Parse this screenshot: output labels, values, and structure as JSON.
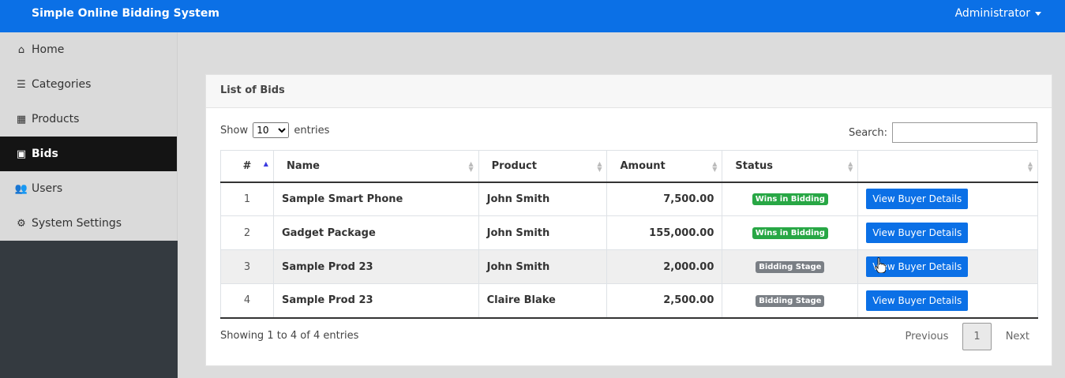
{
  "header": {
    "title": "Simple Online Bidding System",
    "user": "Administrator"
  },
  "sidebar": {
    "items": [
      {
        "label": "Home",
        "icon": "home-icon",
        "glyph": "⌂"
      },
      {
        "label": "Categories",
        "icon": "list-icon",
        "glyph": "☰"
      },
      {
        "label": "Products",
        "icon": "table-icon",
        "glyph": "▦"
      },
      {
        "label": "Bids",
        "icon": "money-icon",
        "glyph": "▣",
        "active": true
      },
      {
        "label": "Users",
        "icon": "users-icon",
        "glyph": "👥"
      },
      {
        "label": "System Settings",
        "icon": "cogs-icon",
        "glyph": "⚙"
      }
    ]
  },
  "card": {
    "title": "List of Bids",
    "show_label": "Show",
    "entries_label": "entries",
    "page_length": "10",
    "search_label": "Search:",
    "search_value": "",
    "columns": [
      "#",
      "Name",
      "Product",
      "Amount",
      "Status",
      ""
    ],
    "rows": [
      {
        "num": "1",
        "name": "Sample Smart Phone",
        "product": "John Smith",
        "amount": "7,500.00",
        "status": "Wins in Bidding",
        "status_type": "success",
        "action": "View Buyer Details"
      },
      {
        "num": "2",
        "name": "Gadget Package",
        "product": "John Smith",
        "amount": "155,000.00",
        "status": "Wins in Bidding",
        "status_type": "success",
        "action": "View Buyer Details"
      },
      {
        "num": "3",
        "name": "Sample Prod 23",
        "product": "John Smith",
        "amount": "2,000.00",
        "status": "Bidding Stage",
        "status_type": "secondary",
        "action": "View Buyer Details"
      },
      {
        "num": "4",
        "name": "Sample Prod 23",
        "product": "Claire Blake",
        "amount": "2,500.00",
        "status": "Bidding Stage",
        "status_type": "secondary",
        "action": "View Buyer Details"
      }
    ],
    "info": "Showing 1 to 4 of 4 entries",
    "pagination": {
      "previous": "Previous",
      "current": "1",
      "next": "Next"
    }
  },
  "colors": {
    "primary": "#0b70e6",
    "success": "#28a745",
    "secondary": "#7a7f85",
    "sidebar_active": "#141414"
  }
}
